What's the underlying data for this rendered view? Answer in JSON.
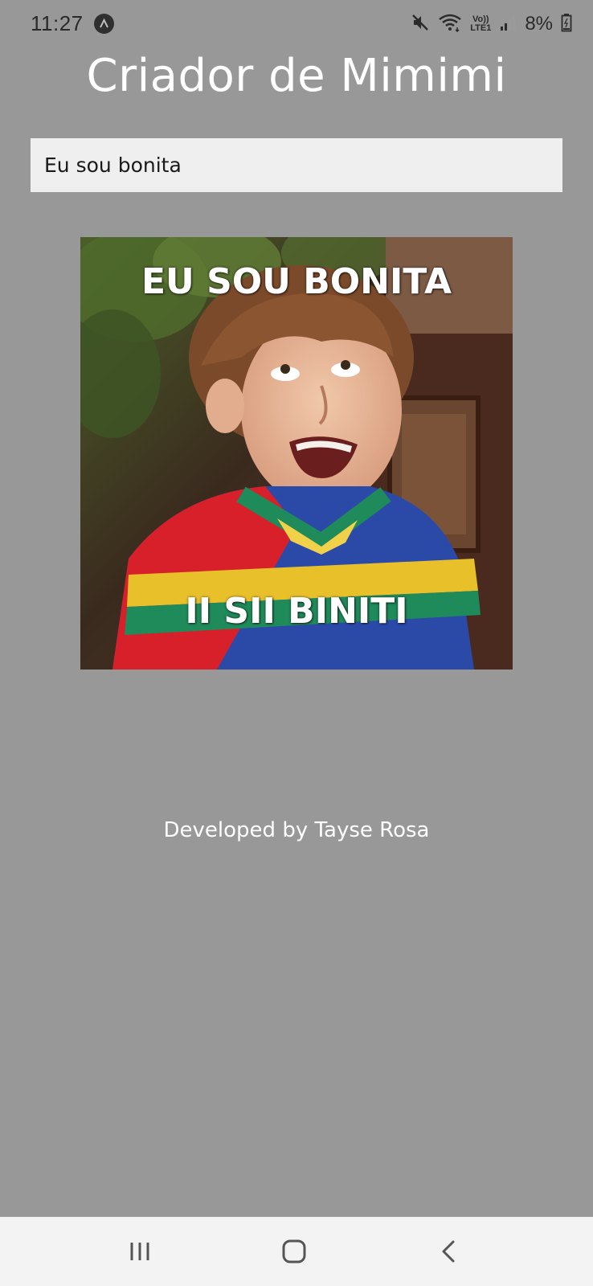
{
  "status_bar": {
    "time": "11:27",
    "battery": "8%",
    "volte_top": "Vo))",
    "volte_bottom": "LTE1",
    "icons": [
      "app-notification-icon",
      "mute-icon",
      "wifi-icon",
      "volte-lte-icon",
      "signal-icon",
      "battery-icon"
    ]
  },
  "app": {
    "title": "Criador de Mimimi"
  },
  "input": {
    "value": "Eu sou bonita"
  },
  "meme": {
    "top_text": "EU SOU BONITA",
    "bottom_text": "II SII BINITI"
  },
  "footer": {
    "credit": "Developed by Tayse Rosa"
  },
  "nav": {
    "icons": [
      "recents-icon",
      "home-icon",
      "back-icon"
    ]
  },
  "colors": {
    "background": "#989898",
    "input_bg": "#efefef",
    "text_white": "#ffffff",
    "nav_bg": "#f3f3f3"
  }
}
